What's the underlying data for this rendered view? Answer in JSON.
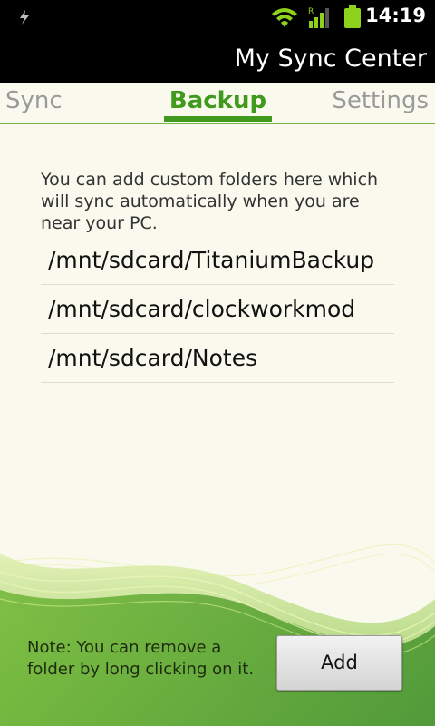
{
  "status_bar": {
    "time": "14:19",
    "icons": [
      "usb-icon",
      "wifi-icon",
      "signal-icon",
      "battery-icon"
    ]
  },
  "app": {
    "title": "My Sync Center"
  },
  "tabs": [
    {
      "label": "Sync",
      "selected": false
    },
    {
      "label": "Backup",
      "selected": true
    },
    {
      "label": "Settings",
      "selected": false
    }
  ],
  "backup": {
    "description": "You can add custom folders here which will sync automatically when you are near your PC.",
    "folders": [
      "/mnt/sdcard/TitaniumBackup",
      "/mnt/sdcard/clockworkmod",
      "/mnt/sdcard/Notes"
    ],
    "note": "Note: You can remove a folder by long clicking on it.",
    "add_label": "Add"
  },
  "colors": {
    "accent": "#3f9a1e",
    "background": "#faf9ee",
    "bar": "#000000"
  }
}
